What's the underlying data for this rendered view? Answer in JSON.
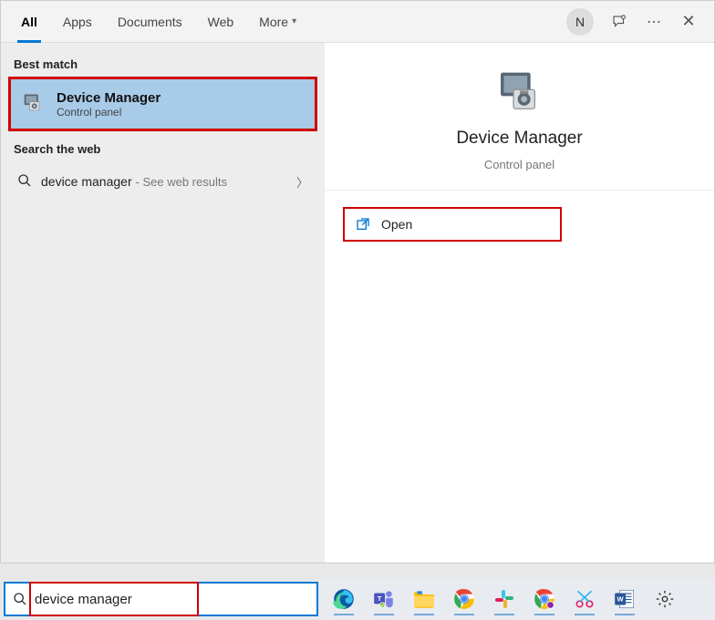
{
  "tabs": {
    "all": "All",
    "apps": "Apps",
    "documents": "Documents",
    "web": "Web",
    "more": "More"
  },
  "avatar_initial": "N",
  "sections": {
    "best_match": "Best match",
    "search_web": "Search the web"
  },
  "best_match": {
    "title": "Device Manager",
    "subtitle": "Control panel"
  },
  "web_result": {
    "query": "device manager",
    "hint": "- See web results"
  },
  "preview": {
    "title": "Device Manager",
    "subtitle": "Control panel"
  },
  "actions": {
    "open": "Open"
  },
  "search_input": {
    "value": "device manager"
  }
}
